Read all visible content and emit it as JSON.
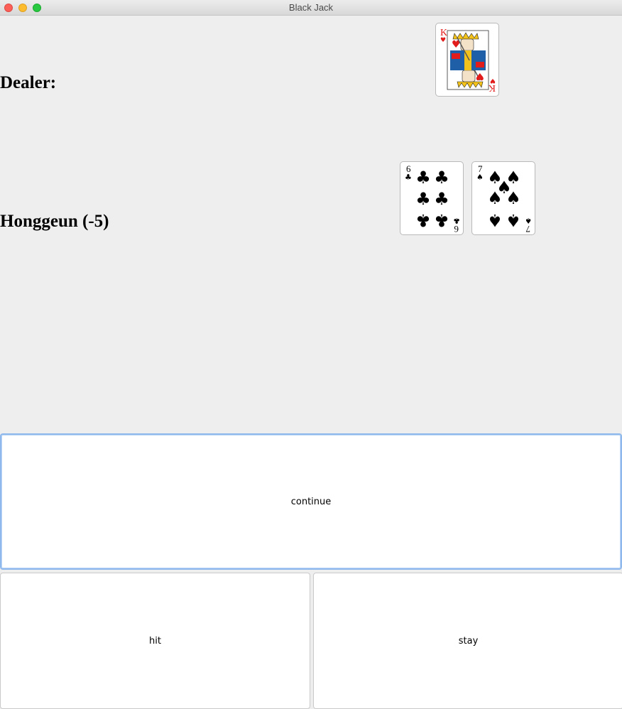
{
  "window": {
    "title": "Black Jack"
  },
  "dealer": {
    "label": "Dealer:",
    "cards": [
      {
        "rank": "K",
        "suit": "hearts",
        "face": "king"
      }
    ]
  },
  "player": {
    "label": "Honggeun (-5)",
    "cards": [
      {
        "rank": "6",
        "suit": "clubs"
      },
      {
        "rank": "7",
        "suit": "spades"
      }
    ]
  },
  "buttons": {
    "continue": "continue",
    "hit": "hit",
    "stay": "stay"
  },
  "colors": {
    "red_suit": "#e21b1b",
    "black_suit": "#000000",
    "focus_ring": "#8fb8ec"
  }
}
